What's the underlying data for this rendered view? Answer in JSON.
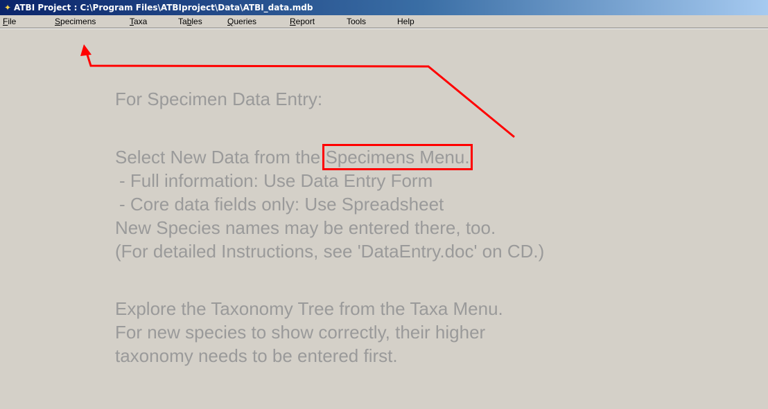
{
  "window": {
    "title": "ATBI Project : C:\\Program Files\\ATBIproject\\Data\\ATBI_data.mdb"
  },
  "icons": {
    "app": "app-icon"
  },
  "menu": {
    "file": {
      "mnemonic": "F",
      "rest": "ile"
    },
    "specimens": {
      "mnemonic": "S",
      "rest": "pecimens"
    },
    "taxa": {
      "mnemonic": "T",
      "rest": "axa"
    },
    "tables": {
      "pre": "Ta",
      "mnemonic": "b",
      "rest": "les"
    },
    "queries": {
      "mnemonic": "Q",
      "rest": "ueries"
    },
    "report": {
      "mnemonic": "R",
      "rest": "eport"
    },
    "tools": {
      "label": "Tools"
    },
    "help": {
      "label": "Help"
    }
  },
  "content": {
    "line1": "For Specimen Data Entry:",
    "line2_prefix": "Select New Data from the ",
    "line2_highlight": "Specimens Menu.",
    "line3": "-   Full information: Use Data Entry Form",
    "line4": "-   Core data fields only: Use Spreadsheet",
    "line5": "New Species names may be entered there, too.",
    "line6": "(For detailed Instructions, see 'DataEntry.doc' on CD.)",
    "line7": "Explore the Taxonomy Tree from the Taxa Menu.",
    "line8": "For new species to show correctly, their higher",
    "line9": "taxonomy needs to be entered first."
  },
  "annotation": {
    "color": "#ff0000"
  },
  "colors": {
    "face": "#d4d0c8",
    "text_gray": "#9a9a9a",
    "title_start": "#0a246a",
    "title_end": "#a6caf0"
  }
}
